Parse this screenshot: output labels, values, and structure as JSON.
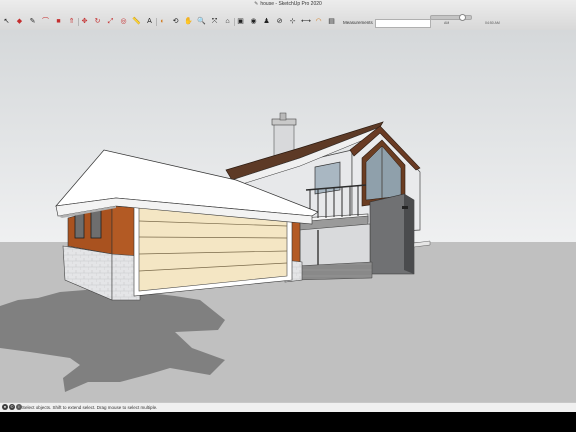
{
  "window": {
    "title": "house - SketchUp Pro 2020"
  },
  "time": {
    "left_label": "AM",
    "right_label": "04:50 AM"
  },
  "toolbar": {
    "tools": [
      {
        "name": "select-tool",
        "icon": "select-arrow-icon",
        "glyph": "↖"
      },
      {
        "name": "eraser-tool",
        "icon": "eraser-icon",
        "glyph": "◆"
      },
      {
        "name": "pencil-tool",
        "icon": "pencil-icon",
        "glyph": "✎"
      },
      {
        "name": "arc-tool",
        "icon": "arc-icon",
        "glyph": "⌒"
      },
      {
        "name": "shape-tool",
        "icon": "shape-icon",
        "glyph": "■"
      },
      {
        "name": "push-pull-tool",
        "icon": "push-pull-icon",
        "glyph": "⇑"
      },
      {
        "name": "move-tool",
        "icon": "move-icon",
        "glyph": "✥"
      },
      {
        "name": "rotate-tool",
        "icon": "rotate-icon",
        "glyph": "↻"
      },
      {
        "name": "scale-tool",
        "icon": "scale-icon",
        "glyph": "⤢"
      },
      {
        "name": "offset-tool",
        "icon": "offset-icon",
        "glyph": "◎"
      },
      {
        "name": "tape-measure-tool",
        "icon": "tape-measure-icon",
        "glyph": "📏"
      },
      {
        "name": "text-tool",
        "icon": "text-icon",
        "glyph": "A"
      },
      {
        "name": "paint-bucket-tool",
        "icon": "paint-bucket-icon",
        "glyph": "◐"
      },
      {
        "name": "orbit-tool",
        "icon": "orbit-icon",
        "glyph": "⟲"
      },
      {
        "name": "pan-tool",
        "icon": "pan-hand-icon",
        "glyph": "✋"
      },
      {
        "name": "zoom-tool",
        "icon": "zoom-icon",
        "glyph": "🔍"
      },
      {
        "name": "zoom-extents-tool",
        "icon": "zoom-extents-icon",
        "glyph": "⤧"
      },
      {
        "name": "warehouse-tool",
        "icon": "warehouse-icon",
        "glyph": "⌂"
      },
      {
        "name": "extension-tool",
        "icon": "extension-icon",
        "glyph": "▣"
      },
      {
        "name": "camera-tool",
        "icon": "camera-icon",
        "glyph": "◉"
      },
      {
        "name": "walk-tool",
        "icon": "walk-icon",
        "glyph": "♟"
      },
      {
        "name": "section-plane-tool",
        "icon": "section-plane-icon",
        "glyph": "⊘"
      },
      {
        "name": "axes-tool",
        "icon": "axes-icon",
        "glyph": "⊹"
      },
      {
        "name": "dimension-tool",
        "icon": "dimension-icon",
        "glyph": "⟷"
      },
      {
        "name": "protractor-tool",
        "icon": "protractor-icon",
        "glyph": "◠"
      },
      {
        "name": "layout-tool",
        "icon": "layout-icon",
        "glyph": "▤"
      }
    ]
  },
  "measurements": {
    "label": "Measurements",
    "value": ""
  },
  "status": {
    "text": "Select objects. Shift to extend select. Drag mouse to select multiple."
  },
  "colors": {
    "sky_top": "#d6d9db",
    "sky_bottom": "#eeeff0",
    "ground": "#bfbfbf",
    "shadow": "#7f7f7f",
    "garage_door": "#f4e6c4",
    "wood_siding": "#b25a26",
    "stucco": "#e7e8ea",
    "roof_brown": "#6a3b24"
  }
}
